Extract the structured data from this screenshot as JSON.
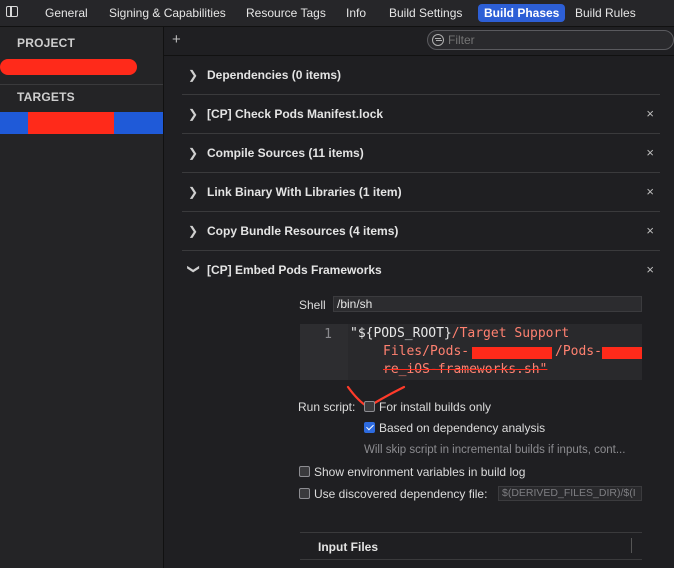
{
  "tabs": [
    "General",
    "Signing & Capabilities",
    "Resource Tags",
    "Info",
    "Build Settings",
    "Build Phases",
    "Build Rules"
  ],
  "active_tab": "Build Phases",
  "sidebar": {
    "project_header": "PROJECT",
    "targets_header": "TARGETS"
  },
  "toolbar": {
    "add_symbol": "+",
    "filter_placeholder": "Filter"
  },
  "phases": [
    {
      "title": "Dependencies (0 items)",
      "expanded": false,
      "removable": false
    },
    {
      "title": "[CP] Check Pods Manifest.lock",
      "expanded": false,
      "removable": true
    },
    {
      "title": "Compile Sources (11 items)",
      "expanded": false,
      "removable": true
    },
    {
      "title": "Link Binary With Libraries (1 item)",
      "expanded": false,
      "removable": true
    },
    {
      "title": "Copy Bundle Resources (4 items)",
      "expanded": false,
      "removable": true
    },
    {
      "title": "[CP] Embed Pods Frameworks",
      "expanded": true,
      "removable": true
    }
  ],
  "close_symbol": "×",
  "embed": {
    "shell_label": "Shell",
    "shell_value": "/bin/sh",
    "line_number": "1",
    "script_lines": [
      {
        "var": "\"${PODS_ROOT}",
        "str": "/Target Support"
      },
      {
        "var": "",
        "str": "Files/Pods-"
      },
      {
        "var": "",
        "str": "/Pods-"
      },
      {
        "var": "",
        "str": "re_iOS-frameworks.sh\""
      }
    ],
    "run_script_label": "Run script:",
    "for_install_label": "For install builds only",
    "for_install_checked": false,
    "dependency_label": "Based on dependency analysis",
    "dependency_checked": true,
    "dependency_hint": "Will skip script in incremental builds if inputs, cont...",
    "show_env_label": "Show environment variables in build log",
    "show_env_checked": false,
    "use_dep_file_label": "Use discovered dependency file:",
    "use_dep_file_checked": false,
    "dep_file_placeholder": "$(DERIVED_FILES_DIR)/$(I",
    "input_files_label": "Input Files"
  },
  "colors": {
    "accent": "#2d5fd6",
    "redaction": "#ff2a1a",
    "string": "#ff8170"
  }
}
